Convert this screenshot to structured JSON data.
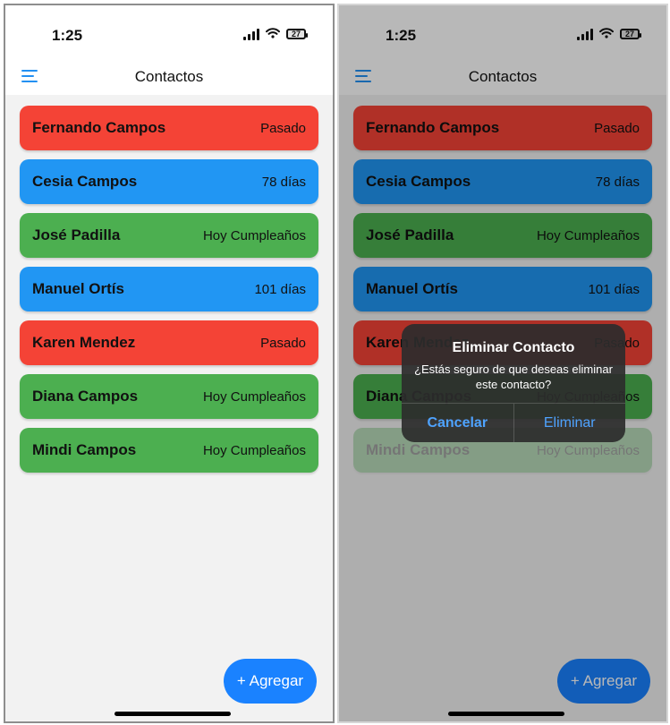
{
  "colors": {
    "red": "#f44336",
    "blue": "#2196f3",
    "green": "#4caf50",
    "accent": "#1a82ff"
  },
  "status": {
    "time": "1:25",
    "battery": "27"
  },
  "header": {
    "title": "Contactos"
  },
  "contacts": [
    {
      "name": "Fernando Campos",
      "status": "Pasado",
      "color": "red"
    },
    {
      "name": "Cesia Campos",
      "status": "78 días",
      "color": "blue"
    },
    {
      "name": "José Padilla",
      "status": "Hoy Cumpleaños",
      "color": "green"
    },
    {
      "name": "Manuel Ortís",
      "status": "101 días",
      "color": "blue"
    },
    {
      "name": "Karen Mendez",
      "status": "Pasado",
      "color": "red"
    },
    {
      "name": "Diana Campos",
      "status": "Hoy Cumpleaños",
      "color": "green"
    },
    {
      "name": "Mindi Campos",
      "status": "Hoy Cumpleaños",
      "color": "green"
    }
  ],
  "fab": {
    "label": "+ Agregar"
  },
  "dialog": {
    "title": "Eliminar Contacto",
    "message": "¿Estás seguro de que deseas eliminar este contacto?",
    "cancel_label": "Cancelar",
    "confirm_label": "Eliminar"
  }
}
